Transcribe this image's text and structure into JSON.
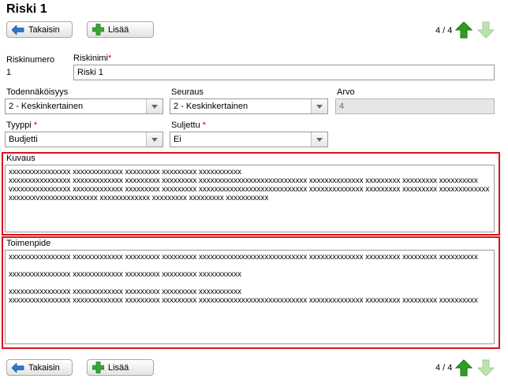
{
  "page": {
    "title": "Riski 1"
  },
  "toolbar_top": {
    "back_label": "Takaisin",
    "add_label": "Lisää",
    "pager": "4 / 4"
  },
  "toolbar_bottom": {
    "back_label": "Takaisin",
    "add_label": "Lisää",
    "pager": "4 / 4"
  },
  "form": {
    "riskinumero": {
      "label": "Riskinumero",
      "value": "1"
    },
    "riskinimi": {
      "label": "Riskinimi",
      "required_mark": "*",
      "value": "Riski 1"
    },
    "todennakoisyys": {
      "label": "Todennäköisyys",
      "value": "2 - Keskinkertainen"
    },
    "seuraus": {
      "label": "Seuraus",
      "value": "2 - Keskinkertainen"
    },
    "arvo": {
      "label": "Arvo",
      "value": "4"
    },
    "tyyppi": {
      "label": "Tyyppi",
      "required_mark": "*",
      "value": "Budjetti"
    },
    "suljettu": {
      "label": "Suljettu",
      "required_mark": "*",
      "value": "Ei"
    },
    "kuvaus": {
      "label": "Kuvaus",
      "value": "xxxxxxxxxxxxxxxx xxxxxxxxxxxxx xxxxxxxxx xxxxxxxxx xxxxxxxxxxx\nxxxxxxxxxxxxxxxx xxxxxxxxxxxxx xxxxxxxxx xxxxxxxxx xxxxxxxxxxxxxxxxxxxxxxxxxxxx xxxxxxxxxxxxxx xxxxxxxxx xxxxxxxxx xxxxxxxxxx\nvxxxxxxxxxxxxxxx xxxxxxxxxxxxx xxxxxxxxx xxxxxxxxx xxxxxxxxxxxxxxxxxxxxxxxxxxxx xxxxxxxxxxxxxx xxxxxxxxx xxxxxxxxx xxxxxxxxxxxxxxxxxxxxvxxxxxxxxxxxxxxx xxxxxxxxxxxxx xxxxxxxxx xxxxxxxxx xxxxxxxxxxx"
    },
    "toimenpide": {
      "label": "Toimenpide",
      "value": "xxxxxxxxxxxxxxxx xxxxxxxxxxxxx xxxxxxxxx xxxxxxxxx xxxxxxxxxxxxxxxxxxxxxxxxxxxx xxxxxxxxxxxxxx xxxxxxxxx xxxxxxxxx xxxxxxxxxx\n\nxxxxxxxxxxxxxxxx xxxxxxxxxxxxx xxxxxxxxx xxxxxxxxx xxxxxxxxxxx\n\nxxxxxxxxxxxxxxxx xxxxxxxxxxxxx xxxxxxxxx xxxxxxxxx xxxxxxxxxxx\nxxxxxxxxxxxxxxxx xxxxxxxxxxxxx xxxxxxxxx xxxxxxxxx xxxxxxxxxxxxxxxxxxxxxxxxxxxx xxxxxxxxxxxxxx xxxxxxxxx xxxxxxxxx xxxxxxxxxx"
    }
  },
  "icons": {
    "back": "arrow-left-icon",
    "add": "plus-icon",
    "prev": "arrow-up-icon",
    "next": "arrow-down-icon",
    "dropdown": "chevron-down-icon"
  },
  "colors": {
    "highlight_border": "#d9121b",
    "nav_up_active": "#2e9e1f",
    "nav_down_disabled": "#bfe0b5",
    "add_icon": "#3aa534",
    "back_icon": "#2f78c9"
  }
}
